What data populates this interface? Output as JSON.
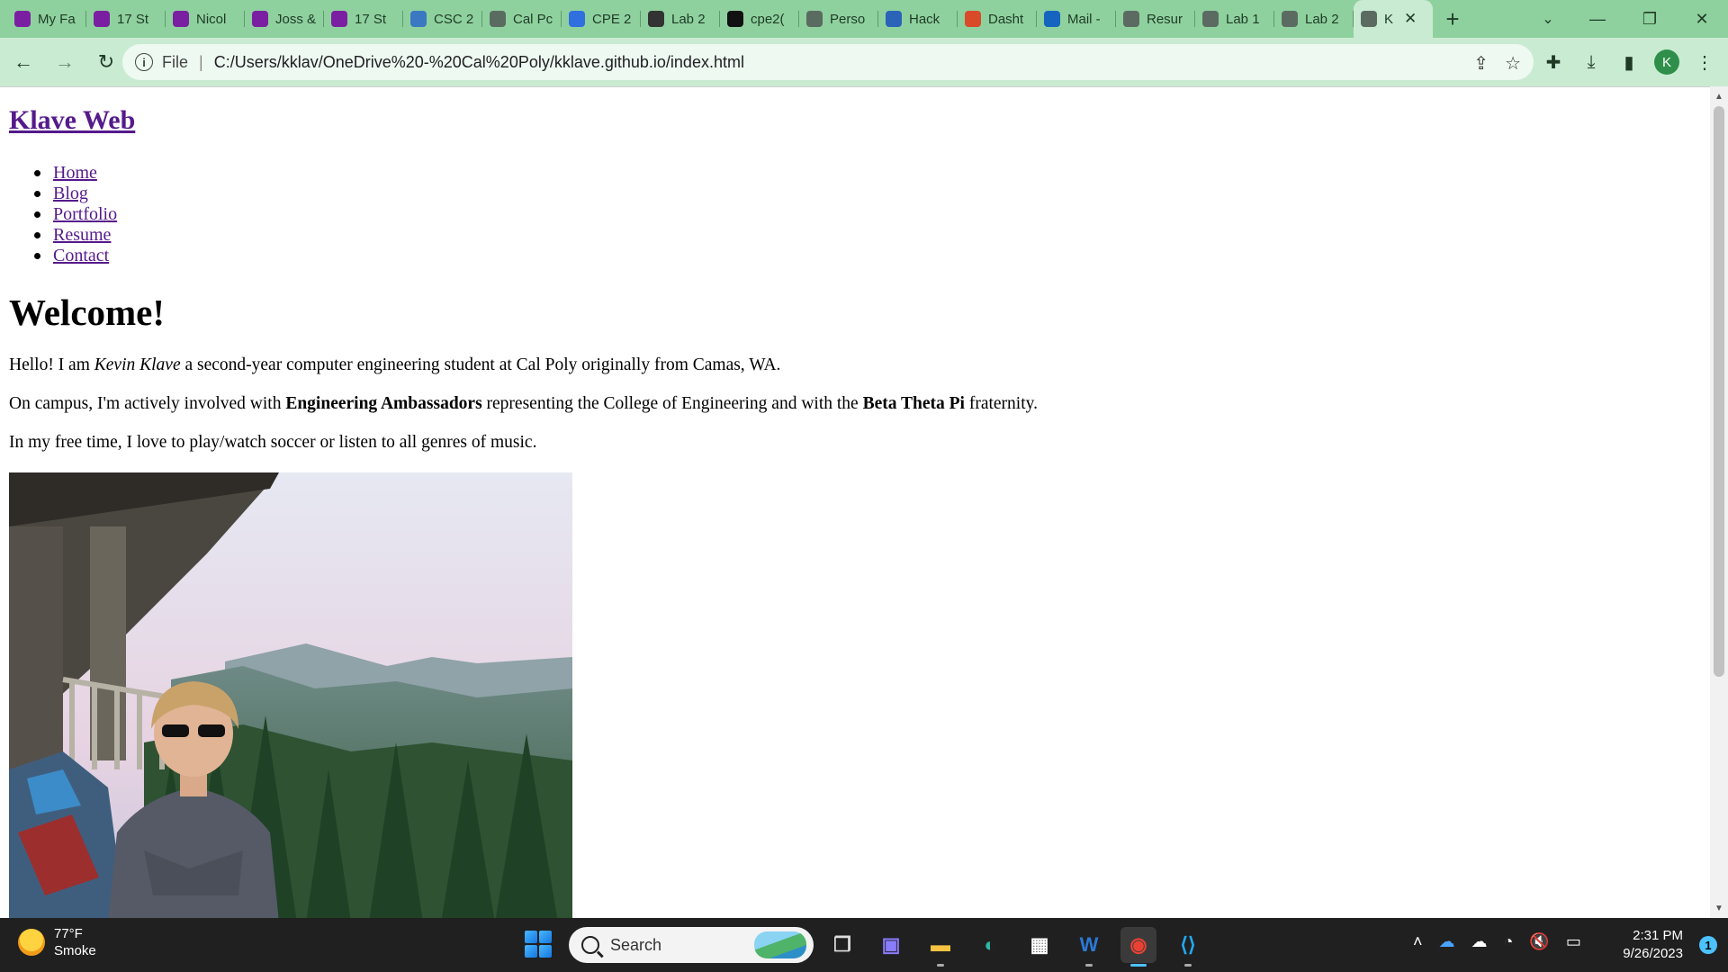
{
  "browser": {
    "tabs": [
      {
        "label": "My Fa",
        "icon": "canvas-icon",
        "color": "#7b1fa2"
      },
      {
        "label": "17 St",
        "icon": "canvas-icon",
        "color": "#7b1fa2"
      },
      {
        "label": "Nicol",
        "icon": "canvas-icon",
        "color": "#7b1fa2"
      },
      {
        "label": "Joss &",
        "icon": "canvas-icon",
        "color": "#7b1fa2"
      },
      {
        "label": "17 St",
        "icon": "canvas-icon",
        "color": "#7b1fa2"
      },
      {
        "label": "CSC 2",
        "icon": "piazza-icon",
        "color": "#3b78c2"
      },
      {
        "label": "Cal Pc",
        "icon": "shield-icon",
        "color": "#5a6b60"
      },
      {
        "label": "CPE 2",
        "icon": "docs-icon",
        "color": "#2f6fde"
      },
      {
        "label": "Lab 2",
        "icon": "lab-icon",
        "color": "#333333"
      },
      {
        "label": "cpe2(",
        "icon": "github-icon",
        "color": "#111111"
      },
      {
        "label": "Perso",
        "icon": "shield-icon",
        "color": "#5a6b60"
      },
      {
        "label": "Hack",
        "icon": "hackerrank-icon",
        "color": "#2a63b8"
      },
      {
        "label": "Dasht",
        "icon": "dashboard-icon",
        "color": "#d84a2a"
      },
      {
        "label": "Mail -",
        "icon": "outlook-icon",
        "color": "#1565c0"
      },
      {
        "label": "Resur",
        "icon": "globe-icon",
        "color": "#5b6b62"
      },
      {
        "label": "Lab 1",
        "icon": "globe-icon",
        "color": "#5b6b62"
      },
      {
        "label": "Lab 2",
        "icon": "globe-icon",
        "color": "#5b6b62"
      }
    ],
    "active_tab": {
      "label": "K",
      "icon": "globe-icon"
    },
    "address": {
      "scheme_label": "File",
      "url": "C:/Users/kklav/OneDrive%20-%20Cal%20Poly/kklave.github.io/index.html"
    },
    "profile_initial": "K"
  },
  "page": {
    "site_title": "Klave Web",
    "nav": [
      "Home",
      "Blog",
      "Portfolio",
      "Resume",
      "Contact"
    ],
    "heading": "Welcome!",
    "p1": {
      "before": "Hello! I am ",
      "name": "Kevin Klave",
      "after": " a second-year computer engineering student at Cal Poly originally from Camas, WA."
    },
    "p2": {
      "before": "On campus, I'm actively involved with ",
      "org1": "Engineering Ambassadors",
      "middle": " representing the College of Engineering and with the ",
      "org2": "Beta Theta Pi",
      "after": " fraternity."
    },
    "p3": "In my free time, I love to play/watch soccer or listen to all genres of music."
  },
  "taskbar": {
    "weather_temp": "77°F",
    "weather_desc": "Smoke",
    "search_placeholder": "Search",
    "time": "2:31 PM",
    "date": "9/26/2023",
    "notification_count": "1"
  }
}
